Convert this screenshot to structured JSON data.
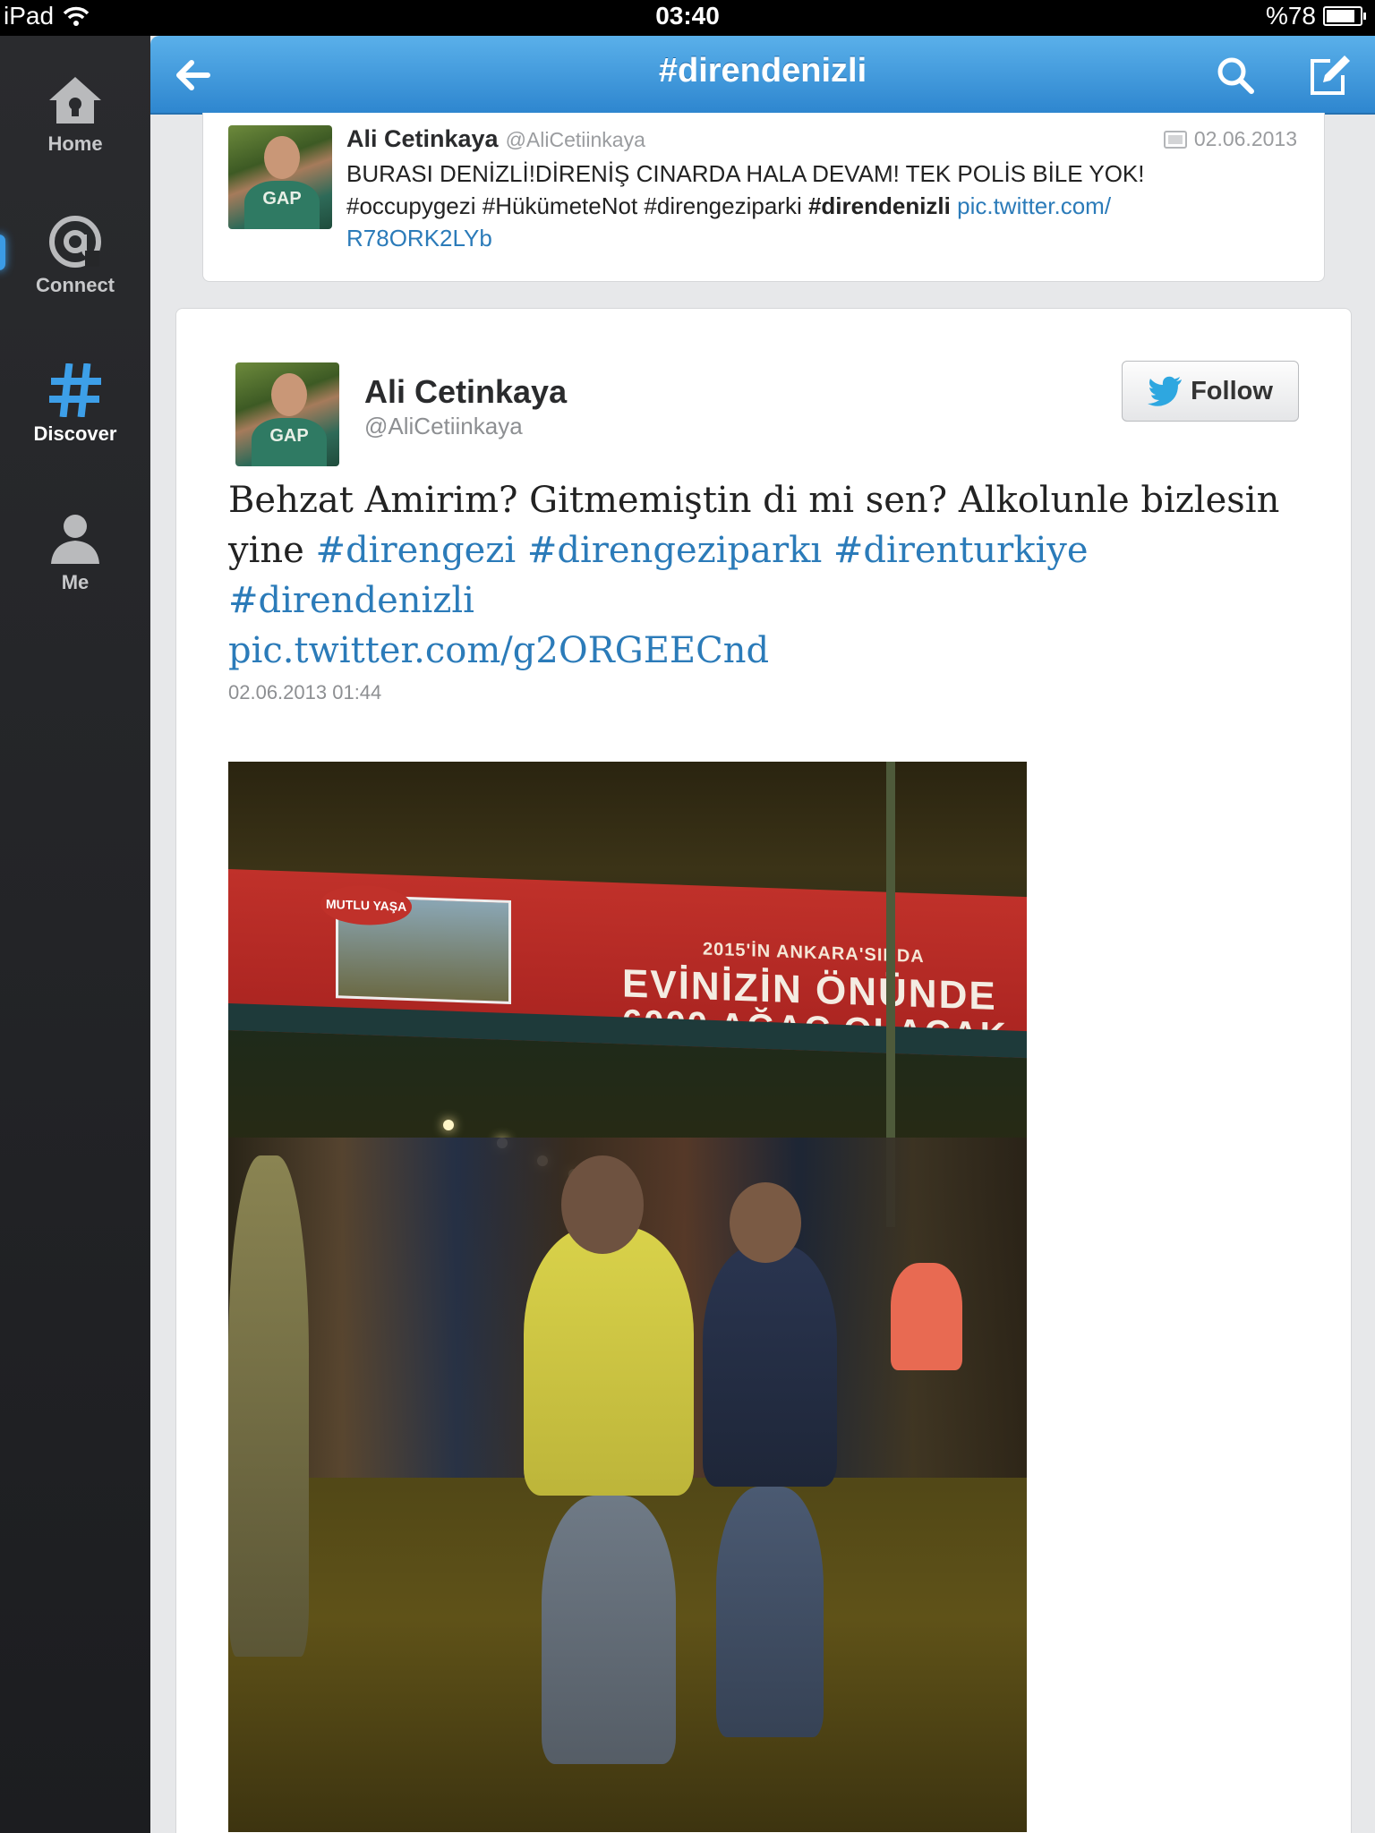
{
  "status_bar": {
    "device": "iPad",
    "time": "03:40",
    "battery": "%78",
    "battery_level": 0.78
  },
  "sidebar": {
    "items": [
      {
        "label": "Home",
        "icon": "home-icon"
      },
      {
        "label": "Connect",
        "icon": "at-icon"
      },
      {
        "label": "Discover",
        "icon": "hash-icon",
        "active": true
      },
      {
        "label": "Me",
        "icon": "person-icon"
      }
    ]
  },
  "header": {
    "title": "#direndenizli",
    "back_icon": "back-arrow-icon",
    "search_icon": "search-icon",
    "compose_icon": "compose-icon"
  },
  "tweet_preview": {
    "name": "Ali Cetinkaya",
    "handle": "@AliCetiinkaya",
    "date": "02.06.2013",
    "text_line1": "BURASI DENİZLİ!DİRENİŞ CINARDA HALA DEVAM! TEK POLİS BİLE YOK!",
    "text_plain": "#occupygezi #HükümeteNot #direngeziparki ",
    "text_bold": "#direndenizli",
    "link_part1": "pic.twitter.com/",
    "link_part2": "R78ORK2LYb"
  },
  "tweet_detail": {
    "name": "Ali Cetinkaya",
    "handle": "@AliCetiinkaya",
    "follow_label": "Follow",
    "text_plain": "Behzat Amirim? Gitmemiştin di mi sen? Alkolunle bizlesin yine ",
    "hashtags": [
      "#direngezi",
      "#direngeziparkı",
      "#direnturkiye",
      "#direndenizli"
    ],
    "link": "pic.twitter.com/g2ORGEECnd",
    "timestamp": "02.06.2013 01:44",
    "photo": {
      "banner_line1": "2015'İN ANKARA'SINDA",
      "banner_line2": "EVİNİZİN ÖNÜNDE",
      "banner_line3": "6000 AĞAÇ OLACAK",
      "billboard_label": "MUTLU YAŞA"
    }
  },
  "colors": {
    "accent": "#2e86cf",
    "link": "#2b7bb9",
    "sidebar": "#1f2023"
  }
}
